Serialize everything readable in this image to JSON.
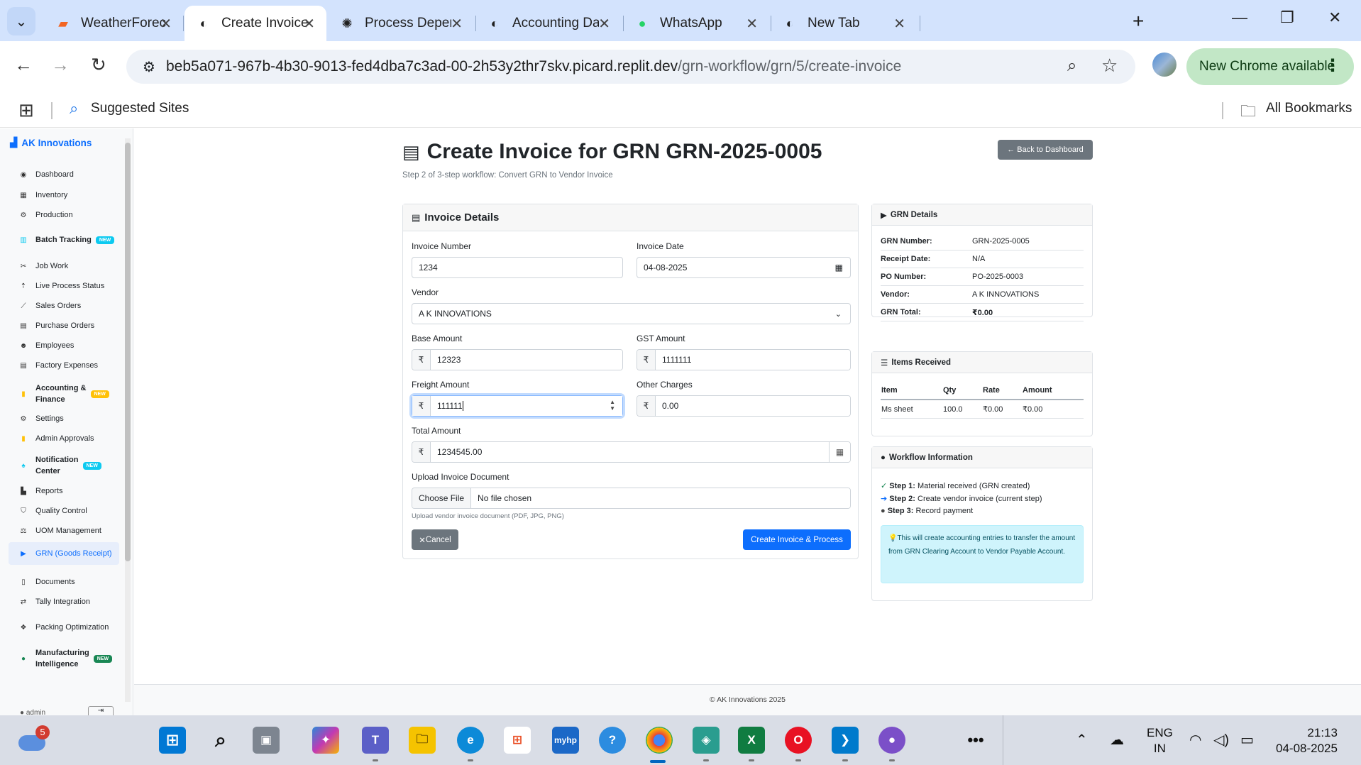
{
  "browser": {
    "tabs": [
      {
        "title": "WeatherForecast -",
        "icon": "stackblitz-icon"
      },
      {
        "title": "Create Invoice for G",
        "icon": "chrome-icon",
        "active": true
      },
      {
        "title": "Process Dependen",
        "icon": "chatgpt-icon"
      },
      {
        "title": "Accounting Dashb",
        "icon": "chrome-icon"
      },
      {
        "title": "WhatsApp",
        "icon": "whatsapp-icon"
      },
      {
        "title": "New Tab",
        "icon": "chrome-icon"
      }
    ],
    "url_host": "beb5a071-967b-4b30-9013-fed4dba7c3ad-00-2h53y2thr7skv.picard.replit.dev",
    "url_path": "/grn-workflow/grn/5/create-invoice",
    "update_chip": "New Chrome available",
    "bookmarks": {
      "suggested": "Suggested Sites",
      "all": "All Bookmarks"
    }
  },
  "sidebar": {
    "brand": "AK Innovations",
    "new_badge": "NEW",
    "items": [
      {
        "label": "Dashboard"
      },
      {
        "label": "Inventory"
      },
      {
        "label": "Production"
      },
      {
        "label": "Batch Tracking"
      },
      {
        "label": "Job Work"
      },
      {
        "label": "Live Process Status"
      },
      {
        "label": "Sales Orders"
      },
      {
        "label": "Purchase Orders"
      },
      {
        "label": "Employees"
      },
      {
        "label": "Factory Expenses"
      },
      {
        "label": "Accounting &",
        "label2": "Finance"
      },
      {
        "label": "Settings"
      },
      {
        "label": "Admin Approvals"
      },
      {
        "label": "Notification",
        "label2": "Center"
      },
      {
        "label": "Reports"
      },
      {
        "label": "Quality Control"
      },
      {
        "label": "UOM Management"
      },
      {
        "label": "GRN (Goods Receipt)"
      },
      {
        "label": "Documents"
      },
      {
        "label": "Tally Integration"
      },
      {
        "label": "Packing Optimization"
      },
      {
        "label": "Manufacturing",
        "label2": "Intelligence"
      }
    ],
    "user": "admin"
  },
  "page": {
    "title": "Create Invoice for GRN GRN-2025-0005",
    "subtitle": "Step 2 of 3-step workflow: Convert GRN to Vendor Invoice",
    "back_button": "Back to Dashboard",
    "footer": "© AK Innovations 2025"
  },
  "invoice_form": {
    "header": "Invoice Details",
    "currency_symbol": "₹",
    "invoice_number": {
      "label": "Invoice Number",
      "value": "1234"
    },
    "invoice_date": {
      "label": "Invoice Date",
      "value": "04-08-2025"
    },
    "vendor": {
      "label": "Vendor",
      "value": "A K INNOVATIONS"
    },
    "base_amount": {
      "label": "Base Amount",
      "value": "12323"
    },
    "gst_amount": {
      "label": "GST Amount",
      "value": "1111111"
    },
    "freight_amount": {
      "label": "Freight Amount",
      "value": "111111"
    },
    "other_charges": {
      "label": "Other Charges",
      "value": "0.00"
    },
    "total_amount": {
      "label": "Total Amount",
      "value": "1234545.00"
    },
    "upload": {
      "label": "Upload Invoice Document",
      "button": "Choose File",
      "status": "No file chosen",
      "help": "Upload vendor invoice document (PDF, JPG, PNG)"
    },
    "cancel_button": "Cancel",
    "submit_button": "Create Invoice & Process"
  },
  "grn_details": {
    "header": "GRN Details",
    "rows": [
      {
        "key": "GRN Number:",
        "value": "GRN-2025-0005"
      },
      {
        "key": "Receipt Date:",
        "value": "N/A"
      },
      {
        "key": "PO Number:",
        "value": "PO-2025-0003"
      },
      {
        "key": "Vendor:",
        "value": "A K INNOVATIONS"
      },
      {
        "key": "GRN Total:",
        "value": "₹0.00"
      }
    ]
  },
  "items_received": {
    "header": "Items Received",
    "columns": [
      "Item",
      "Qty",
      "Rate",
      "Amount"
    ],
    "rows": [
      [
        "Ms sheet",
        "100.0",
        "₹0.00",
        "₹0.00"
      ]
    ]
  },
  "workflow_info": {
    "header": "Workflow Information",
    "steps": [
      {
        "label": "Step 1:",
        "text": "Material received (GRN created)"
      },
      {
        "label": "Step 2:",
        "text": "Create vendor invoice (current step)"
      },
      {
        "label": "Step 3:",
        "text": "Record payment"
      }
    ],
    "note": "This will create accounting entries to transfer the amount from GRN Clearing Account to Vendor Payable Account."
  },
  "taskbar": {
    "weather_badge": "5",
    "lang_line1": "ENG",
    "lang_line2": "IN",
    "time": "21:13",
    "date": "04-08-2025"
  },
  "colors": {
    "primary": "#0d6efd",
    "secondary": "#6c757d",
    "info_bg": "#cff4fc",
    "chrome_tabstrip": "#d3e3fd",
    "update_chip": "#c2e7c6"
  }
}
